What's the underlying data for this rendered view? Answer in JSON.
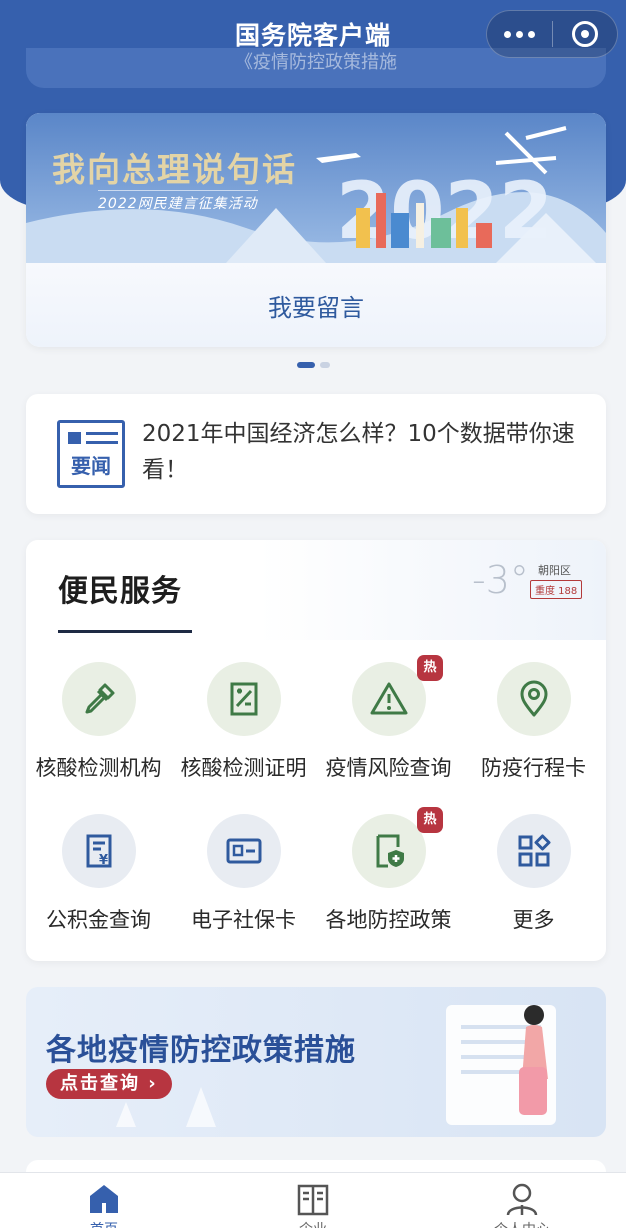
{
  "app": {
    "title": "国务院客户端"
  },
  "prev_card": {
    "text": "《疫情防控政策措施"
  },
  "banner": {
    "title": "我向总理说句话",
    "subtitle": "2022网民建言征集活动",
    "action_label": "我要留言",
    "pages": 2,
    "current_page": 1
  },
  "news": {
    "badge": "要闻",
    "text": "2021年中国经济怎么样？10个数据带你速看！"
  },
  "services": {
    "title": "便民服务",
    "weather": {
      "temp": "-3°",
      "district": "朝阳区",
      "aqi": "重度 188"
    },
    "items": [
      {
        "label": "核酸检测机构",
        "icon": "dropper-icon",
        "hot": false
      },
      {
        "label": "核酸检测证明",
        "icon": "certificate-icon",
        "hot": false
      },
      {
        "label": "疫情风险查询",
        "icon": "warning-icon",
        "hot": true,
        "hot_text": "热"
      },
      {
        "label": "防疫行程卡",
        "icon": "location-pin-icon",
        "hot": false
      },
      {
        "label": "公积金查询",
        "icon": "fund-document-icon",
        "hot": false
      },
      {
        "label": "电子社保卡",
        "icon": "id-card-icon",
        "hot": false
      },
      {
        "label": "各地防控政策",
        "icon": "shield-document-icon",
        "hot": true,
        "hot_text": "热"
      },
      {
        "label": "更多",
        "icon": "grid-more-icon",
        "hot": false
      }
    ]
  },
  "promo": {
    "title": "各地疫情防控政策措施",
    "button": "点击查询 ›"
  },
  "tabbar": {
    "items": [
      {
        "label": "首页",
        "icon": "home-icon",
        "active": true
      },
      {
        "label": "企业",
        "icon": "building-icon",
        "active": false
      },
      {
        "label": "个人中心",
        "icon": "user-icon",
        "active": false
      }
    ]
  },
  "colors": {
    "brand_blue": "#3660ad",
    "hot_red": "#b73540",
    "icon_green": "#3f7a46"
  }
}
